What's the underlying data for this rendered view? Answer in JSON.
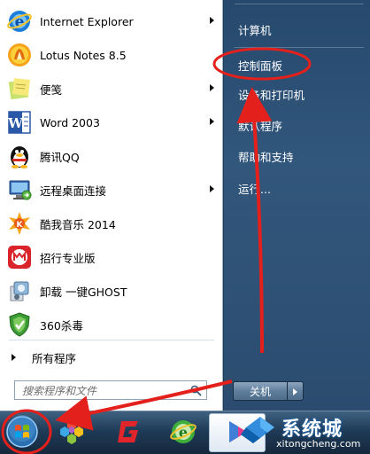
{
  "left_panel": {
    "items": [
      {
        "label": "Internet Explorer",
        "icon": "internet-explorer-icon",
        "has_submenu": true
      },
      {
        "label": "Lotus Notes 8.5",
        "icon": "lotus-notes-icon",
        "has_submenu": false
      },
      {
        "label": "便笺",
        "icon": "sticky-notes-icon",
        "has_submenu": true
      },
      {
        "label": "Word 2003",
        "icon": "word-icon",
        "has_submenu": true
      },
      {
        "label": "腾讯QQ",
        "icon": "qq-penguin-icon",
        "has_submenu": false
      },
      {
        "label": "远程桌面连接",
        "icon": "remote-desktop-icon",
        "has_submenu": true
      },
      {
        "label": "酷我音乐 2014",
        "icon": "kuwo-music-icon",
        "has_submenu": false
      },
      {
        "label": "招行专业版",
        "icon": "cmb-bank-icon",
        "has_submenu": false
      },
      {
        "label": "卸载 一键GHOST",
        "icon": "ghost-icon",
        "has_submenu": false
      },
      {
        "label": "360杀毒",
        "icon": "360-antivirus-icon",
        "has_submenu": false
      }
    ],
    "all_programs": "所有程序",
    "search_placeholder": "搜索程序和文件"
  },
  "right_panel": {
    "items": [
      {
        "label": "计算机"
      },
      {
        "label": "控制面板"
      },
      {
        "label": "设备和打印机"
      },
      {
        "label": "默认程序"
      },
      {
        "label": "帮助和支持"
      },
      {
        "label": "运行..."
      }
    ],
    "shutdown": "关机"
  },
  "watermark": {
    "text": "系统城",
    "url": "xitongcheng.com"
  },
  "colors": {
    "annotation": "#e3201b",
    "right_panel": "#2d5075",
    "taskbar": "#1f3b57"
  }
}
